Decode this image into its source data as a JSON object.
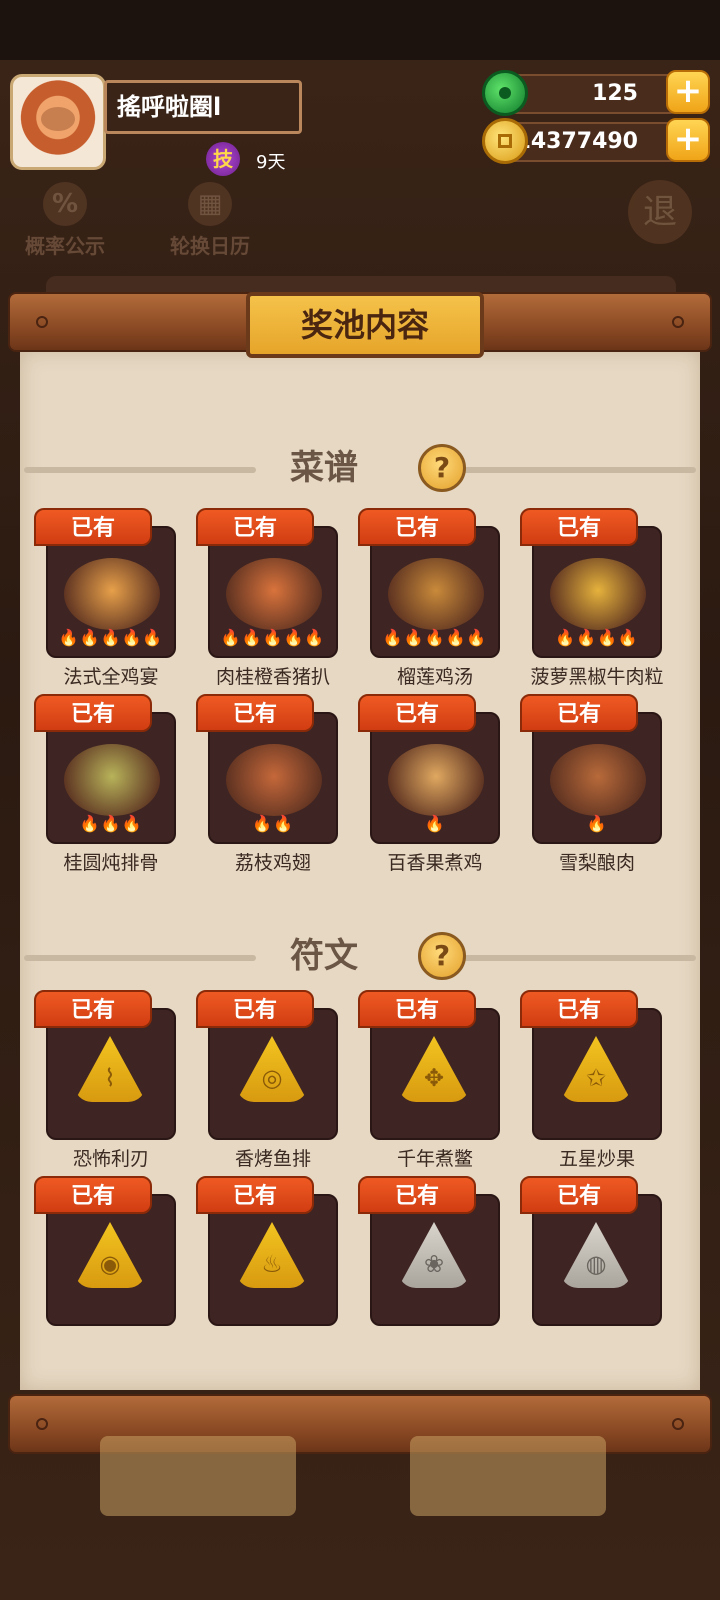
{
  "player": {
    "name": "搖呼啦圈l",
    "skill_badge": "技",
    "skill_days": "9天"
  },
  "resources": {
    "jade": "125",
    "coins": "14377490",
    "plus": "+"
  },
  "nav": {
    "probability": "概率公示",
    "calendar": "轮换日历",
    "exit": "退"
  },
  "modal": {
    "title": "奖池内容",
    "owned_tag": "已有",
    "help": "?",
    "recipes": {
      "label": "菜谱",
      "items": [
        {
          "name": "法式全鸡宴",
          "stars": 5,
          "flames": "🔥🔥🔥🔥🔥"
        },
        {
          "name": "肉桂橙香猪扒",
          "stars": 5,
          "flames": "🔥🔥🔥🔥🔥"
        },
        {
          "name": "榴莲鸡汤",
          "stars": 5,
          "flames": "🔥🔥🔥🔥🔥"
        },
        {
          "name": "菠萝黑椒牛肉粒",
          "stars": 4,
          "flames": "🔥🔥🔥🔥"
        },
        {
          "name": "桂圆炖排骨",
          "stars": 3,
          "flames": "🔥🔥🔥"
        },
        {
          "name": "荔枝鸡翅",
          "stars": 2,
          "flames": "🔥🔥"
        },
        {
          "name": "百香果煮鸡",
          "stars": 1,
          "flames": "🔥"
        },
        {
          "name": "雪梨酿肉",
          "stars": 1,
          "flames": "🔥"
        }
      ]
    },
    "runes": {
      "label": "符文",
      "items": [
        {
          "name": "恐怖利刃",
          "color": "#f2c420",
          "glyph": "⌇"
        },
        {
          "name": "香烤鱼排",
          "color": "#f2c420",
          "glyph": "◎"
        },
        {
          "name": "千年煮鳖",
          "color": "#f2c420",
          "glyph": "✥"
        },
        {
          "name": "五星炒果",
          "color": "#f2c420",
          "glyph": "✩"
        },
        {
          "name": "",
          "color": "#f2c420",
          "glyph": "◉"
        },
        {
          "name": "",
          "color": "#f2c420",
          "glyph": "♨"
        },
        {
          "name": "",
          "color": "#d9d4cc",
          "glyph": "❀"
        },
        {
          "name": "",
          "color": "#d9d4cc",
          "glyph": "◍"
        }
      ]
    }
  }
}
